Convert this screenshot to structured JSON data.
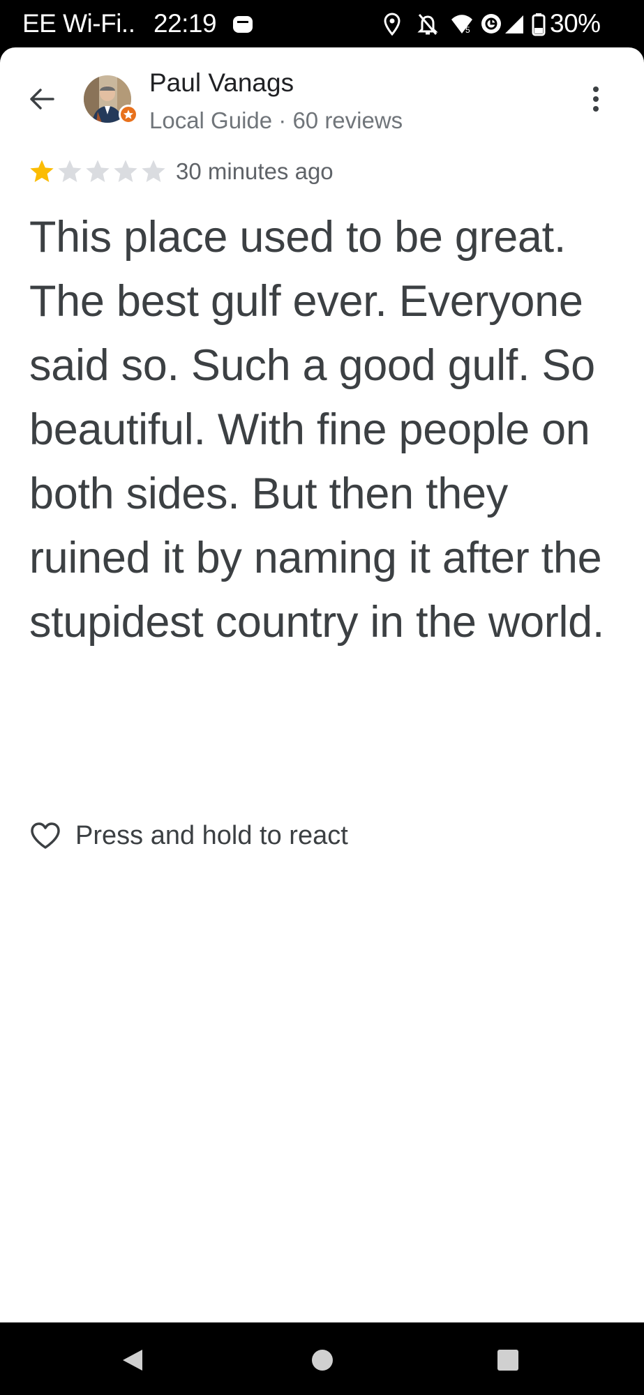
{
  "status_bar": {
    "carrier": "EE Wi-Fi..",
    "time": "22:19",
    "battery": "30%",
    "icons": [
      "message-icon",
      "location-icon",
      "bell-off-icon",
      "wifi-calling-icon",
      "vpn-icon",
      "signal-icon",
      "battery-icon"
    ]
  },
  "header": {
    "back_icon": "arrow-back-icon",
    "reviewer_name": "Paul Vanags",
    "reviewer_meta": "Local Guide · 60 reviews",
    "more_icon": "more-vert-icon"
  },
  "review": {
    "rating": 1,
    "max_rating": 5,
    "time": "30 minutes ago",
    "text": "This place used to be great. The best gulf ever. Everyone said so. Such a good gulf. So beautiful. With fine people on both sides. But then they ruined it by naming it after the stupidest country in the world."
  },
  "reaction": {
    "icon": "heart-outline-icon",
    "label": "Press and hold to react"
  },
  "nav_bar": {
    "buttons": [
      "back-triangle-icon",
      "home-circle-icon",
      "recents-square-icon"
    ]
  },
  "colors": {
    "star_filled": "#fbbc04",
    "star_empty": "#dadce0",
    "badge": "#e8711c",
    "text_primary": "#202124",
    "text_secondary": "#70757a"
  }
}
